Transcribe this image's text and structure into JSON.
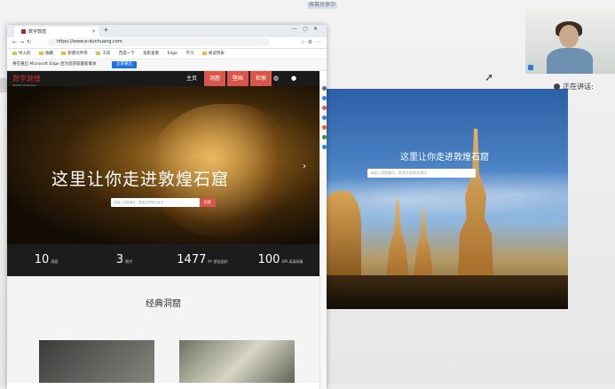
{
  "top_pill": "屏幕共享中",
  "presentation": {
    "title": "这里让你走进敦煌石窟",
    "search_placeholder": "请输入洞窟编号、壁画名称等关键词"
  },
  "meeting": {
    "speaking_label": "正在讲话:"
  },
  "browser": {
    "tab_title": "数字敦煌",
    "url": "https://www.e-dunhuang.com",
    "bookmarks": [
      "导入的",
      "收藏",
      "新建文件夹",
      "工具",
      "百度一下",
      "投影查看",
      "Edge",
      "学习",
      "阅读列表"
    ],
    "infobar_text": "将在重启 Microsoft Edge 后为您获取最新版本",
    "infobar_button": "立即重启"
  },
  "site": {
    "logo": "数字敦煌",
    "logo_sub": "Digital Dunhuang",
    "nav": [
      "主页",
      "洞窟",
      "壁画",
      "检索"
    ],
    "hero_title": "这里让你走进敦煌石窟",
    "search_placeholder": "请输入洞窟编号、壁画名称等关键词",
    "search_button": "检索",
    "stats": [
      {
        "num": "10",
        "unit": "洞窟"
      },
      {
        "num": "3",
        "unit": "朝代"
      },
      {
        "num": "1477",
        "unit": "M² 壁画面积"
      },
      {
        "num": "100",
        "unit": "DPI 高清高精"
      }
    ],
    "section_title": "经典洞窟"
  },
  "colors": {
    "accent": "#d9574a",
    "nav_bg": "#1a1a1a",
    "link_blue": "#1a73e8"
  }
}
